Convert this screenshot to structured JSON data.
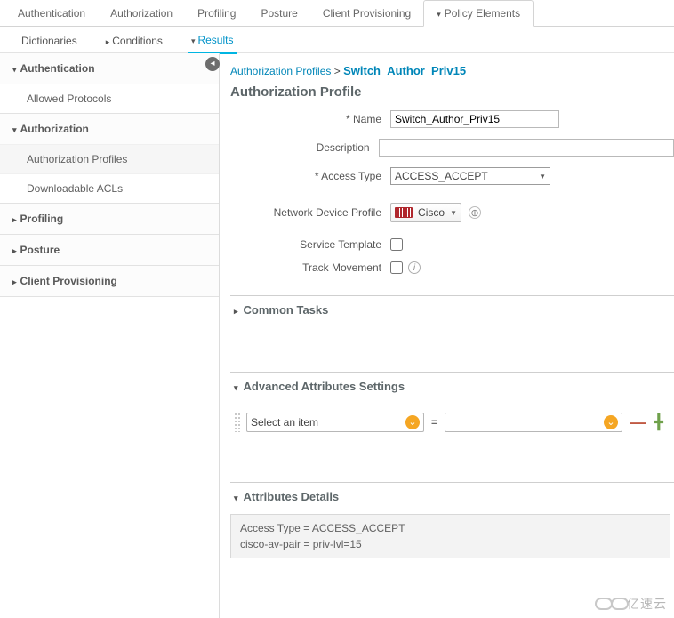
{
  "topTabs": {
    "t0": "Authentication",
    "t1": "Authorization",
    "t2": "Profiling",
    "t3": "Posture",
    "t4": "Client Provisioning",
    "t5": "Policy Elements"
  },
  "subTabs": {
    "s0": "Dictionaries",
    "s1": "Conditions",
    "s2": "Results"
  },
  "sidebar": {
    "authentication": {
      "title": "Authentication",
      "items": {
        "i0": "Allowed Protocols"
      }
    },
    "authorization": {
      "title": "Authorization",
      "items": {
        "i0": "Authorization Profiles",
        "i1": "Downloadable ACLs"
      }
    },
    "profiling": {
      "title": "Profiling"
    },
    "posture": {
      "title": "Posture"
    },
    "clientProvisioning": {
      "title": "Client Provisioning"
    }
  },
  "breadcrumb": {
    "parent": "Authorization Profiles",
    "sep": ">",
    "current": "Switch_Author_Priv15"
  },
  "pageTitle": "Authorization Profile",
  "form": {
    "nameLabel": "* Name",
    "nameValue": "Switch_Author_Priv15",
    "descriptionLabel": "Description",
    "descriptionValue": "",
    "accessTypeLabel": "* Access Type",
    "accessTypeValue": "ACCESS_ACCEPT",
    "ndpLabel": "Network Device Profile",
    "ndpValue": "Cisco",
    "serviceTemplateLabel": "Service Template",
    "trackMovementLabel": "Track Movement"
  },
  "panels": {
    "commonTasks": "Common Tasks",
    "advancedAttributes": "Advanced Attributes Settings",
    "attributesDetails": "Attributes Details"
  },
  "advanced": {
    "selectPlaceholder": "Select an item",
    "valuePlaceholder": ""
  },
  "details": {
    "line0": "Access Type = ACCESS_ACCEPT",
    "line1": "cisco-av-pair = priv-lvl=15"
  },
  "watermark": "亿速云"
}
